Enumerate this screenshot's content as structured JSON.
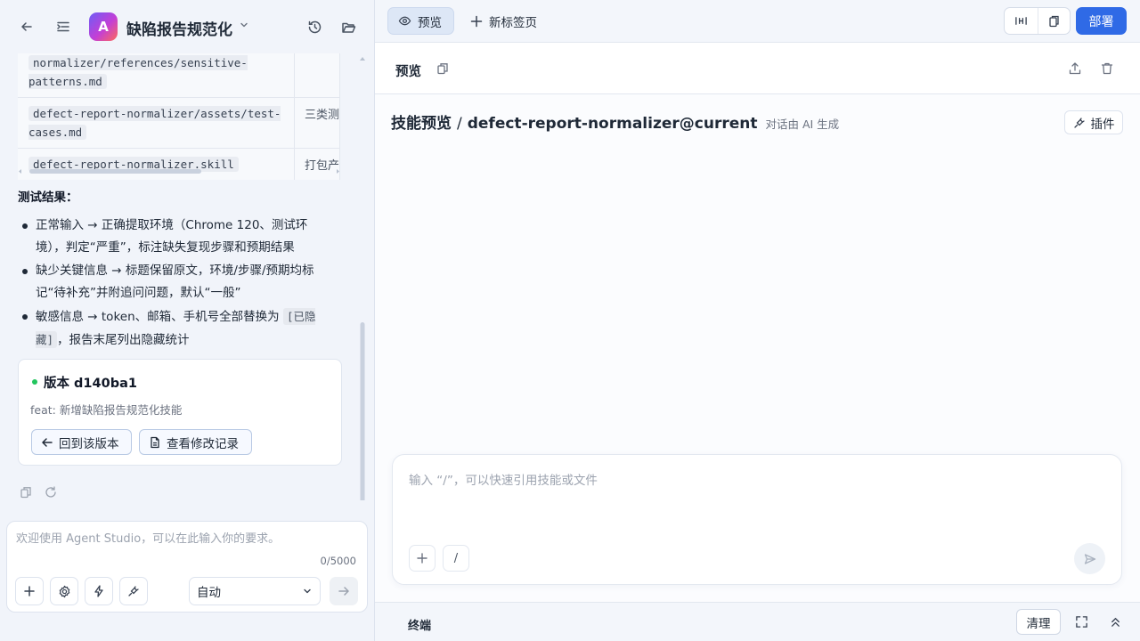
{
  "left_header": {
    "app_initial": "A",
    "app_title": "缺陷报告规范化"
  },
  "file_table": {
    "rows": [
      {
        "path": "normalizer/references/sensitive-patterns.md",
        "desc": ""
      },
      {
        "path": "defect-report-normalizer/assets/test-cases.md",
        "desc": "三类测"
      },
      {
        "path": "defect-report-normalizer.skill",
        "desc": "打包产"
      }
    ]
  },
  "results": {
    "title": "测试结果：",
    "items": [
      "正常输入 → 正确提取环境（Chrome 120、测试环境），判定“严重”，标注缺失复现步骤和预期结果",
      "缺少关键信息 → 标题保留原文，环境/步骤/预期均标记“待补充”并附追问问题，默认“一般”",
      "敏感信息 → token、邮箱、手机号全部替换为",
      "，报告末尾列出隐藏统计"
    ],
    "hidden_tag": "[已隐藏]"
  },
  "version_card": {
    "title": "版本 d140ba1",
    "description": "feat: 新增缺陷报告规范化技能",
    "rollback_label": "回到该版本",
    "history_label": "查看修改记录"
  },
  "chat_input": {
    "placeholder": "欢迎使用 Agent Studio，可以在此输入你的要求。",
    "char_count": "0/5000",
    "mode": "自动"
  },
  "topbar": {
    "tab_preview": "预览",
    "tab_new": "新标签页",
    "deploy_label": "部署"
  },
  "preview_bar": {
    "label": "预览"
  },
  "skill": {
    "title": "技能预览",
    "separator": "/",
    "name": "defect-report-normalizer@current",
    "subtitle": "对话由 AI 生成",
    "plugin_label": "插件"
  },
  "main_input": {
    "placeholder": "输入 “/”，可以快速引用技能或文件",
    "slash_label": "/"
  },
  "terminal": {
    "label": "终端",
    "clear_label": "清理"
  },
  "colors": {
    "accent": "#2f6ae6",
    "version_dot": "#22c55e"
  }
}
